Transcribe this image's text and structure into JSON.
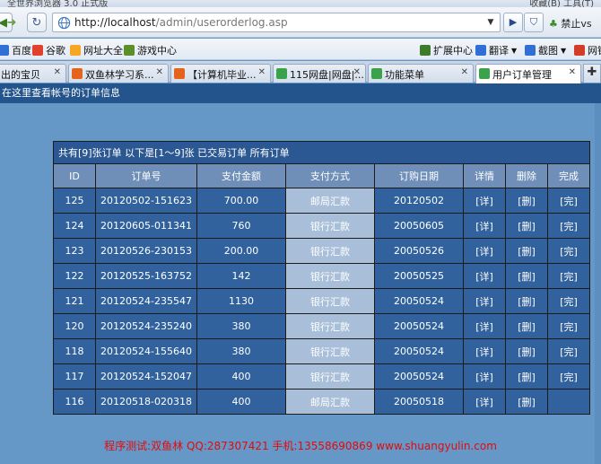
{
  "browser": {
    "title_left": "全世界浏览器 3.0 正式版",
    "title_right": "收藏(B)  工具(T)",
    "url_host": "http://localhost",
    "url_path": "/admin/userorderlog.asp",
    "user_label": "禁止vs"
  },
  "bookmarks": [
    {
      "label": "百度",
      "color": "#2f6fd6"
    },
    {
      "label": "谷歌",
      "color": "#e0412c"
    },
    {
      "label": "网址大全",
      "color": "#f5a623"
    },
    {
      "label": "游戏中心",
      "color": "#5b8f2a"
    }
  ],
  "bookmarks_right": [
    {
      "label": "扩展中心",
      "color": "#3d7a2c"
    },
    {
      "label": "翻译",
      "color": "#2f6fd6"
    },
    {
      "label": "截图",
      "color": "#2f6fd6"
    },
    {
      "label": "网银",
      "color": "#d23c28"
    }
  ],
  "tabs": [
    {
      "label": "出的宝贝",
      "color": "#e28a1c",
      "active": false
    },
    {
      "label": "双鱼林学习系...",
      "color": "#e4641c",
      "active": false
    },
    {
      "label": "【计算机毕业...",
      "color": "#e4641c",
      "active": false
    },
    {
      "label": "115网盘|网盘|...",
      "color": "#3aa24a",
      "active": false
    },
    {
      "label": "功能菜单",
      "color": "#3aa24a",
      "active": false
    },
    {
      "label": "用户订单管理",
      "color": "#3aa24a",
      "active": true
    }
  ],
  "page": {
    "header": "在这里查看帐号的订单信息",
    "summary": "共有[9]张订单  以下是[1～9]张  已交易订单  所有订单"
  },
  "table": {
    "columns": [
      "ID",
      "订单号",
      "支付金额",
      "支付方式",
      "订购日期",
      "详情",
      "删除",
      "完成"
    ],
    "rows": [
      {
        "id": "125",
        "order_no": "20120502-151623",
        "amount": "700.00",
        "method": "邮局汇款",
        "date": "20120502",
        "detail": "[详]",
        "delete": "[删]",
        "done": "[完]"
      },
      {
        "id": "124",
        "order_no": "20120605-011341",
        "amount": "760",
        "method": "银行汇款",
        "date": "20050605",
        "detail": "[详]",
        "delete": "[删]",
        "done": "[完]"
      },
      {
        "id": "123",
        "order_no": "20120526-230153",
        "amount": "200.00",
        "method": "银行汇款",
        "date": "20050526",
        "detail": "[详]",
        "delete": "[删]",
        "done": "[完]"
      },
      {
        "id": "122",
        "order_no": "20120525-163752",
        "amount": "142",
        "method": "银行汇款",
        "date": "20050525",
        "detail": "[详]",
        "delete": "[删]",
        "done": "[完]"
      },
      {
        "id": "121",
        "order_no": "20120524-235547",
        "amount": "1130",
        "method": "银行汇款",
        "date": "20050524",
        "detail": "[详]",
        "delete": "[删]",
        "done": "[完]"
      },
      {
        "id": "120",
        "order_no": "20120524-235240",
        "amount": "380",
        "method": "银行汇款",
        "date": "20050524",
        "detail": "[详]",
        "delete": "[删]",
        "done": "[完]"
      },
      {
        "id": "118",
        "order_no": "20120524-155640",
        "amount": "380",
        "method": "银行汇款",
        "date": "20050524",
        "detail": "[详]",
        "delete": "[删]",
        "done": "[完]"
      },
      {
        "id": "117",
        "order_no": "20120524-152047",
        "amount": "400",
        "method": "银行汇款",
        "date": "20050524",
        "detail": "[详]",
        "delete": "[删]",
        "done": "[完]"
      },
      {
        "id": "116",
        "order_no": "20120518-020318",
        "amount": "400",
        "method": "邮局汇款",
        "date": "20050518",
        "detail": "[详]",
        "delete": "[删]",
        "done": ""
      }
    ]
  },
  "footer": "程序测试:双鱼林 QQ:287307421 手机:13558690869 www.shuangyulin.com"
}
